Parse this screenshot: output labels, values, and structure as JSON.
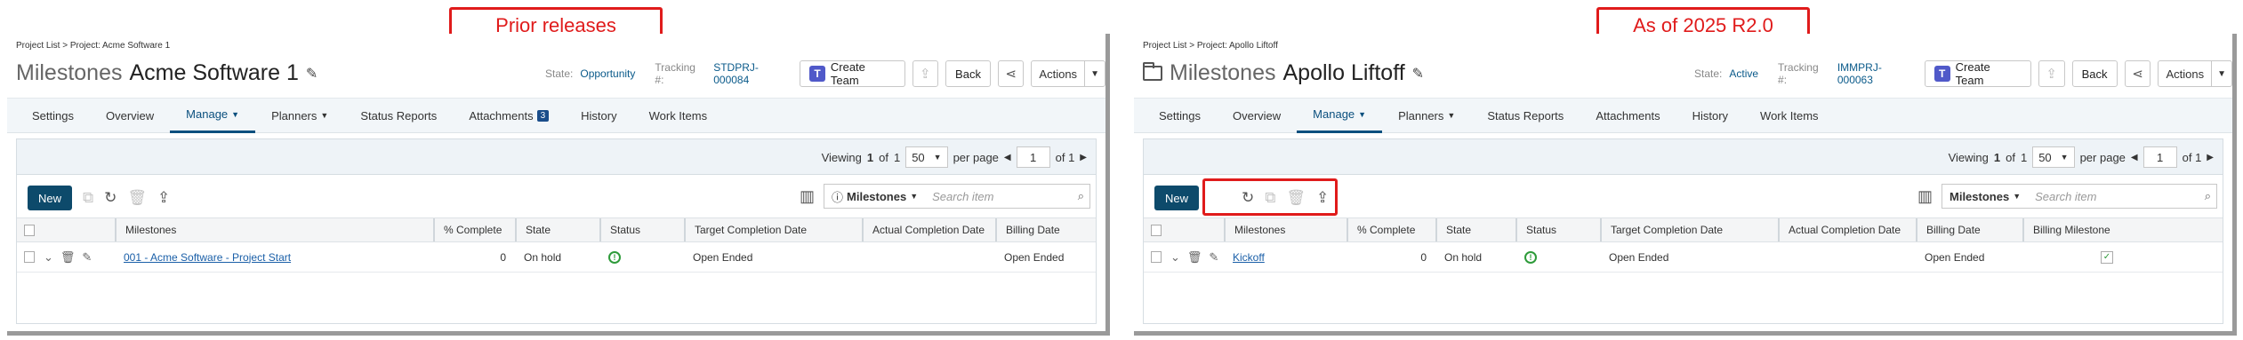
{
  "callouts": {
    "left": "Prior releases",
    "right": "As of 2025 R2.0"
  },
  "colors": {
    "accent": "#0a4f7e",
    "highlight": "#e01b1b",
    "new_button": "#0d4a6b",
    "status_green": "#2e9b3a"
  },
  "left": {
    "breadcrumb": "Project List > Project: Acme Software 1",
    "title_prefix": "Milestones",
    "title_name": "Acme Software 1",
    "state_label": "State:",
    "state_value": "Opportunity",
    "tracking_label": "Tracking #:",
    "tracking_value": "STDPRJ-000084",
    "create_team": "Create Team",
    "back": "Back",
    "actions": "Actions",
    "tabs": [
      {
        "label": "Settings"
      },
      {
        "label": "Overview"
      },
      {
        "label": "Manage"
      },
      {
        "label": "Planners"
      },
      {
        "label": "Status Reports"
      },
      {
        "label": "Attachments",
        "badge": "3"
      },
      {
        "label": "History"
      },
      {
        "label": "Work Items"
      }
    ],
    "pager": {
      "viewing": "Viewing",
      "from": "1",
      "of_label": "of",
      "total": "1",
      "per_page_value": "50",
      "per_page": "per page",
      "page": "1",
      "page_of": "of 1"
    },
    "new_label": "New",
    "search_scope": "Milestones",
    "search_placeholder": "Search item",
    "columns": [
      "Milestones",
      "% Complete",
      "State",
      "Status",
      "Target Completion Date",
      "Actual Completion Date",
      "Billing Date"
    ],
    "row": {
      "name": "001 - Acme Software - Project Start",
      "pct": "0",
      "state": "On hold",
      "target": "Open Ended",
      "actual": "",
      "billing": "Open Ended"
    }
  },
  "right": {
    "breadcrumb": "Project List > Project: Apollo Liftoff",
    "title_prefix": "Milestones",
    "title_name": "Apollo Liftoff",
    "state_label": "State:",
    "state_value": "Active",
    "tracking_label": "Tracking #:",
    "tracking_value": "IMMPRJ-000063",
    "create_team": "Create Team",
    "back": "Back",
    "actions": "Actions",
    "tabs": [
      {
        "label": "Settings"
      },
      {
        "label": "Overview"
      },
      {
        "label": "Manage"
      },
      {
        "label": "Planners"
      },
      {
        "label": "Status Reports"
      },
      {
        "label": "Attachments"
      },
      {
        "label": "History"
      },
      {
        "label": "Work Items"
      }
    ],
    "pager": {
      "viewing": "Viewing",
      "from": "1",
      "of_label": "of",
      "total": "1",
      "per_page_value": "50",
      "per_page": "per page",
      "page": "1",
      "page_of": "of 1"
    },
    "new_label": "New",
    "search_scope": "Milestones",
    "search_placeholder": "Search item",
    "columns": [
      "Milestones",
      "% Complete",
      "State",
      "Status",
      "Target Completion Date",
      "Actual Completion Date",
      "Billing Date",
      "Billing Milestone"
    ],
    "row": {
      "name": "Kickoff",
      "pct": "0",
      "state": "On hold",
      "target": "Open Ended",
      "actual": "",
      "billing": "Open Ended"
    }
  }
}
